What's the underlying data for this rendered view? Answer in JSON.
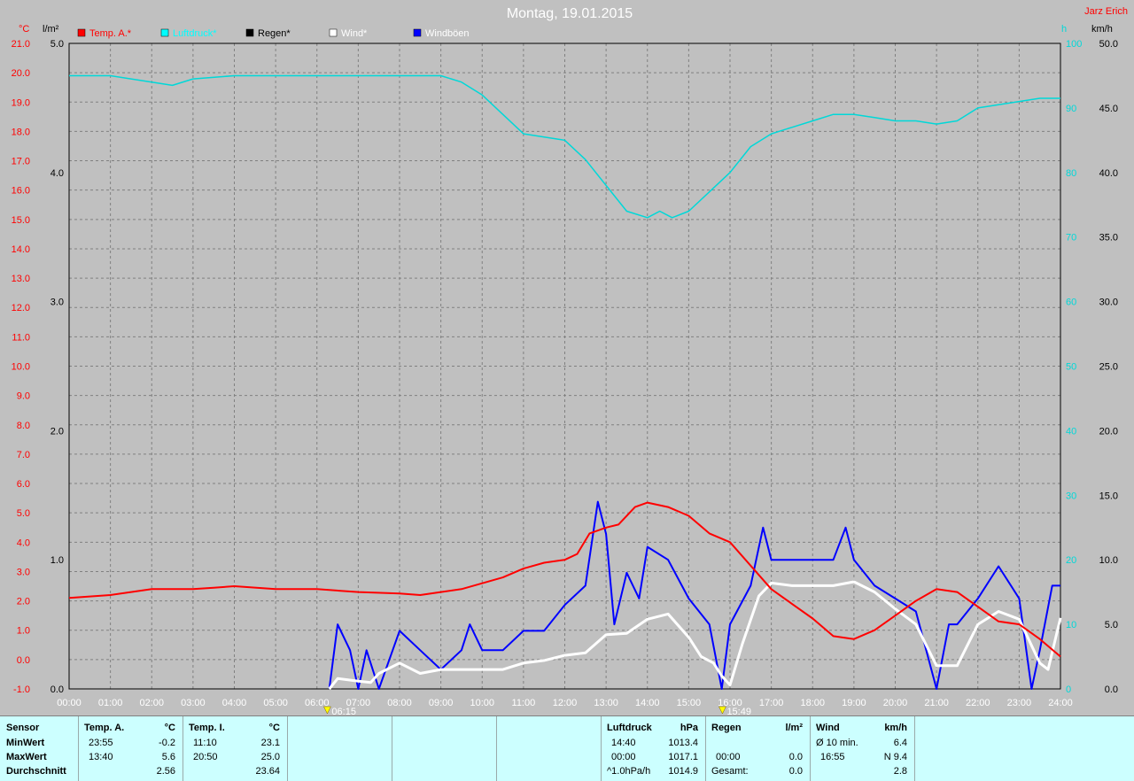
{
  "title": "Montag, 19.01.2015",
  "author": "Jarz Erich",
  "colors": {
    "background": "#c0c0c0",
    "temp": "#ff0000",
    "pressure": "#00d8d8",
    "rain": "#000000",
    "wind": "#ffffff",
    "gust": "#0000ff",
    "panel": "#ccffff"
  },
  "axes": {
    "temp_unit": "°C",
    "rain_unit": "l/m²",
    "pressure_unit": "h",
    "wind_unit": "km/h",
    "temp_ticks": [
      "21.0",
      "20.0",
      "19.0",
      "18.0",
      "17.0",
      "16.0",
      "15.0",
      "14.0",
      "13.0",
      "12.0",
      "11.0",
      "10.0",
      "9.0",
      "8.0",
      "7.0",
      "6.0",
      "5.0",
      "4.0",
      "3.0",
      "2.0",
      "1.0",
      "0.0",
      "-1.0"
    ],
    "rain_ticks": [
      "5.0",
      "4.0",
      "3.0",
      "2.0",
      "1.0",
      "0.0"
    ],
    "pressure_ticks": [
      "100",
      "90",
      "80",
      "70",
      "60",
      "50",
      "40",
      "30",
      "20",
      "10",
      "0"
    ],
    "wind_ticks": [
      "50.0",
      "45.0",
      "40.0",
      "35.0",
      "30.0",
      "25.0",
      "20.0",
      "15.0",
      "10.0",
      "5.0",
      "0.0"
    ],
    "time_ticks": [
      "00:00",
      "01:00",
      "02:00",
      "03:00",
      "04:00",
      "05:00",
      "06:00",
      "07:00",
      "08:00",
      "09:00",
      "10:00",
      "11:00",
      "12:00",
      "13:00",
      "14:00",
      "15:00",
      "16:00",
      "17:00",
      "18:00",
      "19:00",
      "20:00",
      "21:00",
      "22:00",
      "23:00",
      "24:00"
    ]
  },
  "markers": {
    "sunrise": "06:15",
    "sunset": "15:49"
  },
  "legend": [
    {
      "label": "Temp. A.*",
      "color": "#ff0000"
    },
    {
      "label": "Luftdruck*",
      "color": "#00ffff"
    },
    {
      "label": "Regen*",
      "color": "#000000"
    },
    {
      "label": "Wind*",
      "color": "#ffffff"
    },
    {
      "label": "Windböen",
      "color": "#0000ff"
    }
  ],
  "chart_data": {
    "type": "line",
    "title": "Montag, 19.01.2015",
    "x_range": [
      "00:00",
      "24:00"
    ],
    "ylim_temp": [
      -1.0,
      21.0
    ],
    "ylim_rain": [
      0.0,
      5.0
    ],
    "ylim_wind": [
      0.0,
      50.0
    ],
    "grid": true,
    "series": [
      {
        "name": "Temp. A.*",
        "axis": "temp",
        "points": [
          [
            0,
            2.1
          ],
          [
            1,
            2.2
          ],
          [
            1.5,
            2.3
          ],
          [
            2,
            2.4
          ],
          [
            3,
            2.4
          ],
          [
            3.5,
            2.45
          ],
          [
            4,
            2.5
          ],
          [
            5,
            2.4
          ],
          [
            6,
            2.4
          ],
          [
            7,
            2.3
          ],
          [
            8,
            2.25
          ],
          [
            8.5,
            2.2
          ],
          [
            9,
            2.3
          ],
          [
            9.5,
            2.4
          ],
          [
            10,
            2.6
          ],
          [
            10.5,
            2.8
          ],
          [
            11,
            3.1
          ],
          [
            11.5,
            3.3
          ],
          [
            12,
            3.4
          ],
          [
            12.3,
            3.6
          ],
          [
            12.6,
            4.3
          ],
          [
            13,
            4.5
          ],
          [
            13.3,
            4.6
          ],
          [
            13.7,
            5.2
          ],
          [
            14,
            5.35
          ],
          [
            14.5,
            5.2
          ],
          [
            15,
            4.9
          ],
          [
            15.5,
            4.3
          ],
          [
            16,
            4.0
          ],
          [
            16.5,
            3.2
          ],
          [
            17,
            2.4
          ],
          [
            17.5,
            1.9
          ],
          [
            18,
            1.4
          ],
          [
            18.5,
            0.8
          ],
          [
            19,
            0.7
          ],
          [
            19.5,
            1.0
          ],
          [
            20,
            1.5
          ],
          [
            20.5,
            2.0
          ],
          [
            21,
            2.4
          ],
          [
            21.5,
            2.3
          ],
          [
            22,
            1.8
          ],
          [
            22.5,
            1.3
          ],
          [
            23,
            1.2
          ],
          [
            23.5,
            0.7
          ],
          [
            24,
            0.1
          ]
        ]
      },
      {
        "name": "Luftdruck*",
        "axis": "pressure_pct",
        "points": [
          [
            0,
            95
          ],
          [
            1,
            95
          ],
          [
            2,
            94
          ],
          [
            2.5,
            93.5
          ],
          [
            3,
            94.5
          ],
          [
            4,
            95
          ],
          [
            5,
            95
          ],
          [
            6,
            95
          ],
          [
            7,
            95
          ],
          [
            8,
            95
          ],
          [
            9,
            95
          ],
          [
            9.5,
            94
          ],
          [
            10,
            92
          ],
          [
            10.5,
            89
          ],
          [
            11,
            86
          ],
          [
            11.5,
            85.5
          ],
          [
            12,
            85
          ],
          [
            12.5,
            82
          ],
          [
            13,
            78
          ],
          [
            13.5,
            74
          ],
          [
            14,
            73
          ],
          [
            14.3,
            74
          ],
          [
            14.6,
            73
          ],
          [
            15,
            74
          ],
          [
            15.5,
            77
          ],
          [
            16,
            80
          ],
          [
            16.5,
            84
          ],
          [
            17,
            86
          ],
          [
            17.5,
            87
          ],
          [
            18,
            88
          ],
          [
            18.5,
            89
          ],
          [
            19,
            89
          ],
          [
            19.5,
            88.5
          ],
          [
            20,
            88
          ],
          [
            20.5,
            88
          ],
          [
            21,
            87.5
          ],
          [
            21.5,
            88
          ],
          [
            22,
            90
          ],
          [
            22.5,
            90.5
          ],
          [
            23,
            91
          ],
          [
            23.5,
            91.5
          ],
          [
            24,
            91.5
          ]
        ]
      },
      {
        "name": "Wind*",
        "axis": "wind",
        "points": [
          [
            6.3,
            0
          ],
          [
            6.5,
            0.8
          ],
          [
            7,
            0.6
          ],
          [
            7.3,
            0.5
          ],
          [
            7.5,
            1.2
          ],
          [
            8,
            2.0
          ],
          [
            8.5,
            1.2
          ],
          [
            9,
            1.5
          ],
          [
            9.5,
            1.5
          ],
          [
            10,
            1.5
          ],
          [
            10.5,
            1.5
          ],
          [
            11,
            2.0
          ],
          [
            11.5,
            2.2
          ],
          [
            12,
            2.6
          ],
          [
            12.5,
            2.8
          ],
          [
            13,
            4.2
          ],
          [
            13.5,
            4.3
          ],
          [
            14,
            5.4
          ],
          [
            14.5,
            5.8
          ],
          [
            15,
            4.0
          ],
          [
            15.3,
            2.5
          ],
          [
            15.6,
            2.0
          ],
          [
            15.8,
            1.0
          ],
          [
            16,
            0.3
          ],
          [
            16.3,
            3.5
          ],
          [
            16.7,
            7.2
          ],
          [
            17,
            8.2
          ],
          [
            17.5,
            8.0
          ],
          [
            18,
            8.0
          ],
          [
            18.5,
            8.0
          ],
          [
            19,
            8.3
          ],
          [
            19.5,
            7.5
          ],
          [
            20,
            6.2
          ],
          [
            20.5,
            5.0
          ],
          [
            21,
            1.8
          ],
          [
            21.5,
            1.8
          ],
          [
            22,
            5.0
          ],
          [
            22.5,
            6.0
          ],
          [
            23,
            5.4
          ],
          [
            23.5,
            2.0
          ],
          [
            23.7,
            1.5
          ],
          [
            24,
            5.5
          ]
        ]
      },
      {
        "name": "Windböen",
        "axis": "wind",
        "points": [
          [
            6.3,
            0
          ],
          [
            6.5,
            5
          ],
          [
            6.8,
            3
          ],
          [
            7,
            0
          ],
          [
            7.2,
            3
          ],
          [
            7.5,
            0
          ],
          [
            8,
            4.5
          ],
          [
            8.5,
            3
          ],
          [
            9,
            1.5
          ],
          [
            9.5,
            3
          ],
          [
            9.7,
            5
          ],
          [
            10,
            3
          ],
          [
            10.5,
            3
          ],
          [
            11,
            4.5
          ],
          [
            11.5,
            4.5
          ],
          [
            12,
            6.5
          ],
          [
            12.5,
            8
          ],
          [
            12.8,
            14.5
          ],
          [
            13,
            12
          ],
          [
            13.2,
            5
          ],
          [
            13.5,
            9
          ],
          [
            13.8,
            7
          ],
          [
            14,
            11
          ],
          [
            14.5,
            10
          ],
          [
            15,
            7
          ],
          [
            15.5,
            5
          ],
          [
            15.8,
            0
          ],
          [
            16,
            5
          ],
          [
            16.5,
            8
          ],
          [
            16.8,
            12.5
          ],
          [
            17,
            10
          ],
          [
            17.5,
            10
          ],
          [
            18,
            10
          ],
          [
            18.5,
            10
          ],
          [
            18.8,
            12.5
          ],
          [
            19,
            10
          ],
          [
            19.5,
            8
          ],
          [
            20,
            7
          ],
          [
            20.5,
            6
          ],
          [
            21,
            0
          ],
          [
            21.3,
            5
          ],
          [
            21.5,
            5
          ],
          [
            22,
            7
          ],
          [
            22.5,
            9.5
          ],
          [
            23,
            7
          ],
          [
            23.3,
            0
          ],
          [
            23.5,
            3
          ],
          [
            23.8,
            8
          ],
          [
            24,
            8
          ]
        ]
      }
    ]
  },
  "stats": {
    "sensor": {
      "header": "Sensor",
      "rows": [
        "MinWert",
        "MaxWert",
        "Durchschnitt"
      ]
    },
    "temp_a": {
      "header": "Temp. A.",
      "unit": "°C",
      "min_time": "23:55",
      "min": "-0.2",
      "max_time": "13:40",
      "max": "5.6",
      "avg": "2.56"
    },
    "temp_i": {
      "header": "Temp. I.",
      "unit": "°C",
      "min_time": "11:10",
      "min": "23.1",
      "max_time": "20:50",
      "max": "25.0",
      "avg": "23.64"
    },
    "pressure": {
      "header": "Luftdruck",
      "unit": "hPa",
      "min_time": "14:40",
      "min": "1013.4",
      "max_time": "00:00",
      "max": "1017.1",
      "trend_label": "^1.0hPa/h",
      "trend": "1014.9"
    },
    "rain": {
      "header": "Regen",
      "unit": "l/m²",
      "max_time": "00:00",
      "max": "0.0",
      "total_label": "Gesamt:",
      "total": "0.0"
    },
    "wind": {
      "header": "Wind",
      "unit": "km/h",
      "avg_label": "Ø 10 min.",
      "avg": "6.4",
      "max_time": "16:55",
      "max": "N 9.4",
      "mean": "2.8"
    }
  }
}
